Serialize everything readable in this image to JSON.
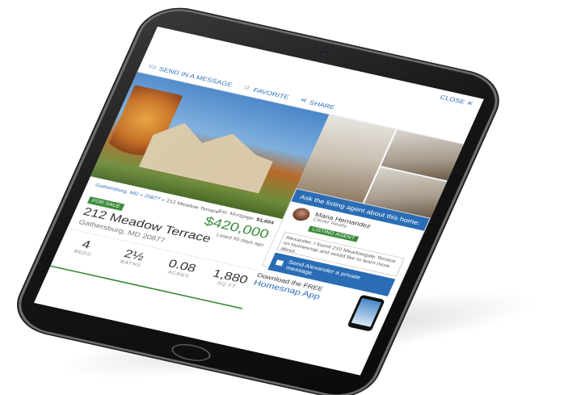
{
  "topbar": {
    "close_label": "CLOSE"
  },
  "toolbar": {
    "send_label": "SEND IN A MESSAGE",
    "favorite_label": "FAVORITE",
    "share_label": "SHARE"
  },
  "listing": {
    "breadcrumb": [
      "Gathersburg, MD",
      "20877"
    ],
    "breadcrumb_current": "212 Meadow Terrace",
    "status_badge": "FOR SALE",
    "address": "212 Meadow Terrace",
    "city_line": "Gathersburg, MD 20877",
    "mortgage_label": "Est. Mortgage",
    "mortgage_value": "$1,604",
    "price": "$420,000",
    "listed_ago": "Listed 55 days ago",
    "stats": [
      {
        "value": "4",
        "label": "BEDS"
      },
      {
        "value": "2½",
        "label": "BATHS"
      },
      {
        "value": "0.08",
        "label": "ACRES"
      },
      {
        "value": "1,880",
        "label": "SQ FT"
      }
    ]
  },
  "agent": {
    "header": "Ask the listing agent about this home:",
    "name": "Maria Hernandez",
    "company": "Clever Realty",
    "badge": "LISTING AGENT",
    "message": "Alexander, I found 210 Meadowgate Terrace on Homesnap and would like to learn more about",
    "send_label": "Send Alexander a private message"
  },
  "promo": {
    "line1": "Download the FREE",
    "line2": "Homesnap App"
  },
  "icons": {
    "send": "chat-icon",
    "favorite": "star-icon",
    "share": "share-icon",
    "close": "close-icon"
  },
  "colors": {
    "accent_blue": "#2a6db5",
    "accent_green": "#3b8a3a"
  }
}
